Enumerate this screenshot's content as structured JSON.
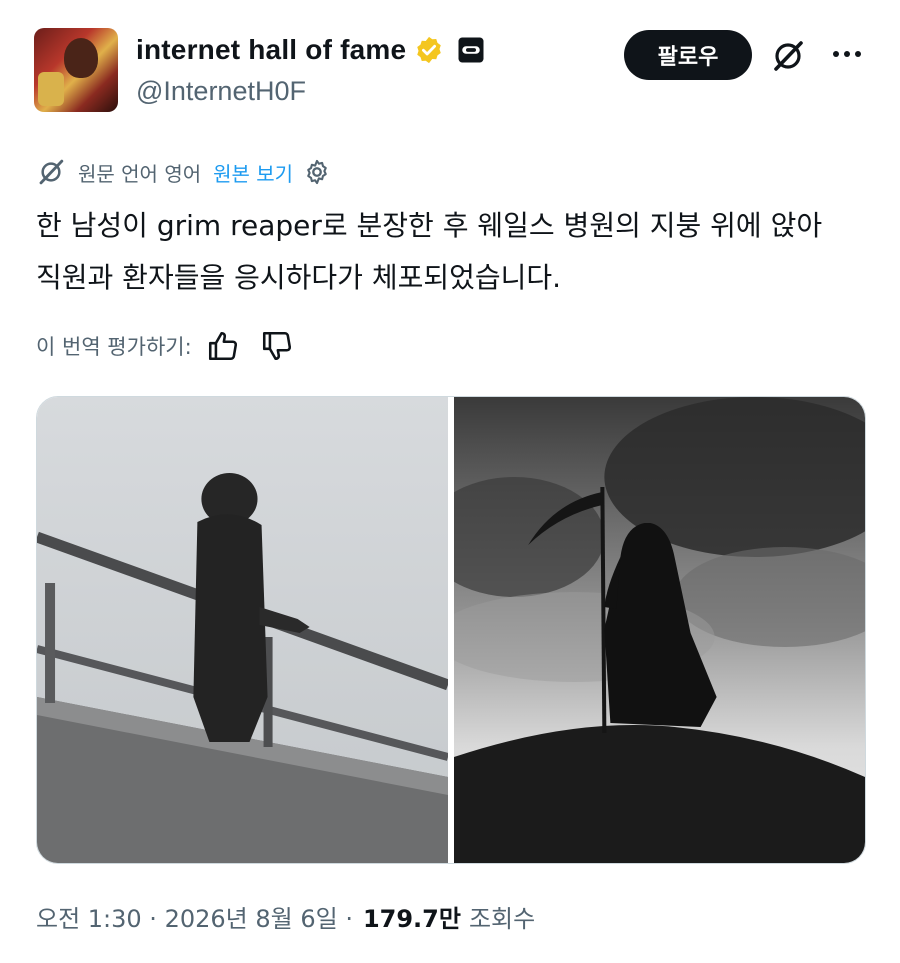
{
  "author": {
    "display_name": "internet hall of fame",
    "handle": "@InternetH0F",
    "avatar_icon": "avatar-photo",
    "verified_color": "#f4c61f"
  },
  "header": {
    "follow_label": "팔로우",
    "grok_icon": "grok-icon",
    "more_icon": "more-icon"
  },
  "translation": {
    "info_label": "원문 언어 영어",
    "view_original_label": "원본 보기",
    "settings_icon": "gear-icon"
  },
  "tweet": {
    "text": "한 남성이 grim reaper로 분장한 후 웨일스 병원의 지붕 위에 앉아 직원과 환자들을 응시하다가 체포되었습니다."
  },
  "rating": {
    "label": "이 번역 평가하기:",
    "up_icon": "thumbs-up-icon",
    "down_icon": "thumbs-down-icon"
  },
  "meta": {
    "timestamp": "오전 1:30 · 2026년 8월 6일 ·",
    "views_count": "179.7만",
    "views_label": "조회수"
  },
  "colors": {
    "text_primary": "#0f1419",
    "text_secondary": "#536471",
    "link": "#1d9bf0"
  }
}
